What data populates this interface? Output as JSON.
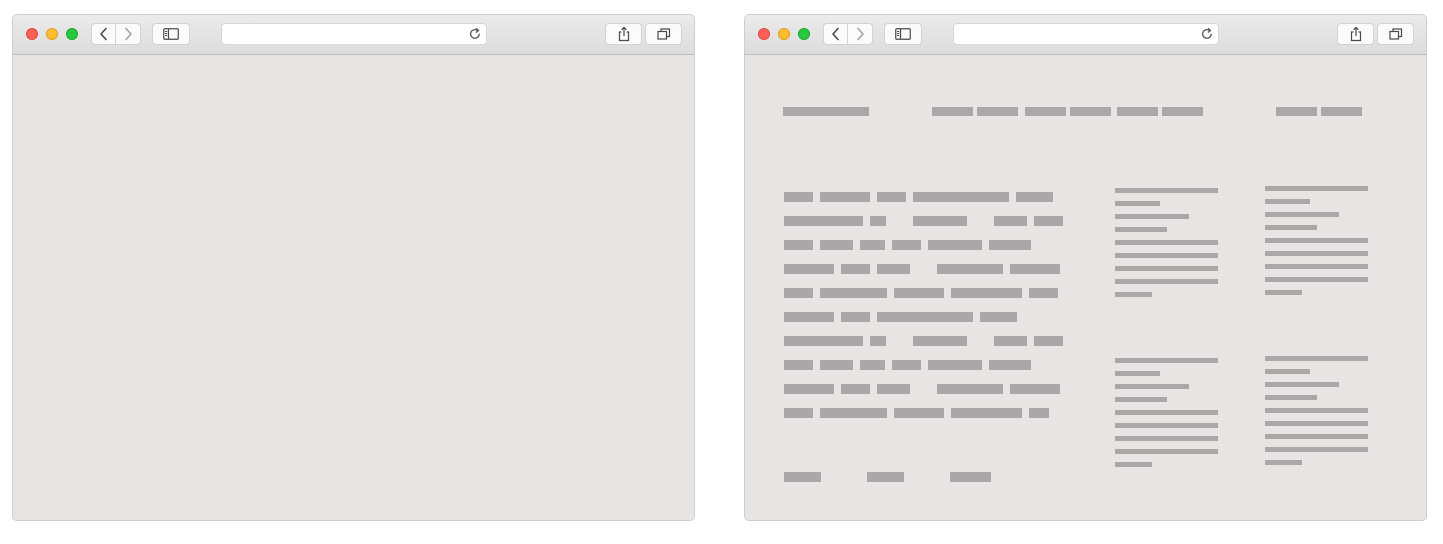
{
  "windows": [
    {
      "name": "empty-browser-window",
      "url_value": "",
      "url_placeholder": ""
    },
    {
      "name": "wireframe-browser-window",
      "url_value": "",
      "url_placeholder": ""
    }
  ],
  "icons": {
    "close": "traffic-light-close",
    "minimize": "traffic-light-minimize",
    "maximize": "traffic-light-maximize",
    "back": "chevron-left-icon",
    "forward": "chevron-right-icon",
    "sidebar": "sidebar-icon",
    "reload": "reload-icon",
    "share": "share-icon",
    "tabs": "tabs-overview-icon"
  },
  "colors": {
    "window_bg": "#e7e5e4",
    "placeholder_block": "#a9a7a7",
    "close": "#fe5f57",
    "minimize": "#febc2e",
    "maximize": "#28c840"
  }
}
